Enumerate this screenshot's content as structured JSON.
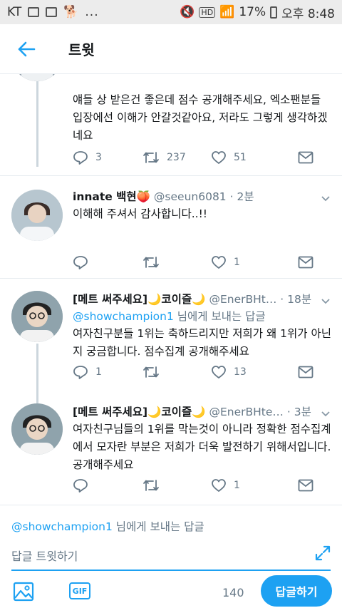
{
  "status_bar": {
    "carrier": "KT",
    "battery": "17%",
    "time": "오후 8:48",
    "extra": "..."
  },
  "header": {
    "title": "트윗"
  },
  "tweets": [
    {
      "text": "얘들 상 받은건 좋은데 점수 공개해주세요, 엑소팬분들 입장에선 이해가 안갈것같아요, 저라도 그렇게 생각하겠네요",
      "reply_count": "3",
      "retweet_count": "237",
      "like_count": "51"
    },
    {
      "name": "innate 백현🍑",
      "handle": "@seeun6081",
      "time": "2분",
      "text": "이해해 주셔서 감사합니다..!!",
      "reply_count": "",
      "retweet_count": "",
      "like_count": "1"
    },
    {
      "name": "[메트 써주세요]🌙코이즐🌙",
      "handle": "@EnerBHt…",
      "time": "18분",
      "replying_to": "@showchampion1",
      "replying_suffix": " 님에게 보내는 답글",
      "text": "여자친구분들 1위는 축하드리지만 저희가 왜 1위가 아닌지 궁금합니다. 점수집계 공개해주세요",
      "reply_count": "1",
      "retweet_count": "",
      "like_count": "13"
    },
    {
      "name": "[메트 써주세요]🌙코이즐🌙",
      "handle": "@EnerBHte…",
      "time": "3분",
      "text": "여자친구님들의 1위를 막는것이 아니라 정확한 점수집계에서 모자란 부분은 저희가 더욱 발전하기 위해서입니다. 공개해주세요",
      "reply_count": "",
      "retweet_count": "",
      "like_count": "1"
    }
  ],
  "composer": {
    "replying_to": "@showchampion1",
    "replying_suffix": " 님에게 보내는 답글",
    "placeholder": "답글 트윗하기",
    "gif_label": "GIF",
    "char_count": "140",
    "reply_button": "답글하기"
  },
  "colors": {
    "accent": "#1da1f2",
    "muted": "#657786",
    "text": "#14171a",
    "divider": "#e6ecf0"
  },
  "icons": {
    "back": "arrow-left-icon",
    "reply": "reply-icon",
    "retweet": "retweet-icon",
    "like": "heart-icon",
    "dm": "envelope-icon",
    "caret": "chevron-down-icon",
    "media": "image-icon",
    "expand": "expand-icon"
  }
}
